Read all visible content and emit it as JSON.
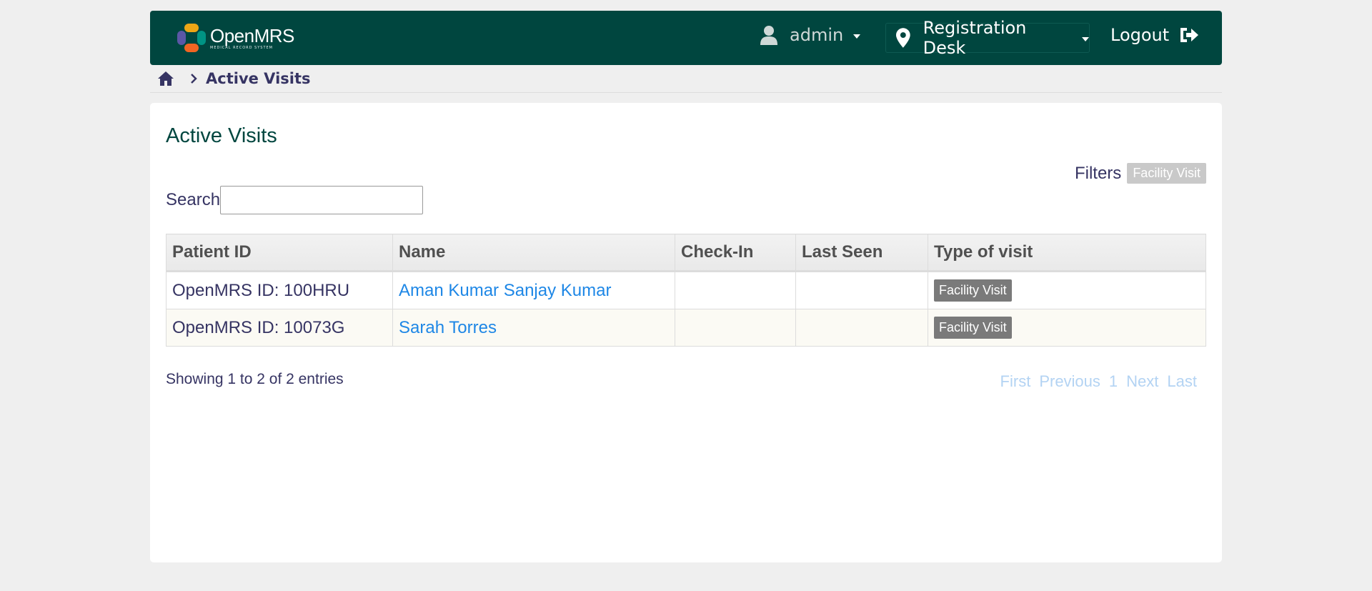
{
  "header": {
    "logo_title": "OpenMRS",
    "logo_subtitle": "MEDICAL RECORD SYSTEM",
    "user": "admin",
    "location": "Registration Desk",
    "logout": "Logout"
  },
  "breadcrumb": {
    "current": "Active Visits"
  },
  "page": {
    "title": "Active Visits",
    "filters_label": "Filters",
    "filter_chip": "Facility Visit",
    "search_label": "Search",
    "search_value": ""
  },
  "table": {
    "columns": [
      "Patient ID",
      "Name",
      "Check-In",
      "Last Seen",
      "Type of visit"
    ],
    "rows": [
      {
        "patient_id": "OpenMRS ID: 100HRU",
        "name": "Aman Kumar Sanjay Kumar",
        "check_in": "",
        "last_seen": "",
        "type": "Facility Visit"
      },
      {
        "patient_id": "OpenMRS ID: 10073G",
        "name": "Sarah Torres",
        "check_in": "",
        "last_seen": "",
        "type": "Facility Visit"
      }
    ]
  },
  "footer": {
    "info": "Showing 1 to 2 of 2 entries",
    "pager": {
      "first": "First",
      "previous": "Previous",
      "page": "1",
      "next": "Next",
      "last": "Last"
    }
  },
  "colors": {
    "header_bg": "#00463f",
    "link": "#1e87e6",
    "badge": "#7a7a7a",
    "chip": "#c9c9c9"
  },
  "icons": {
    "user": "user-icon",
    "location": "map-pin-icon",
    "logout": "logout-icon",
    "home": "home-icon"
  }
}
